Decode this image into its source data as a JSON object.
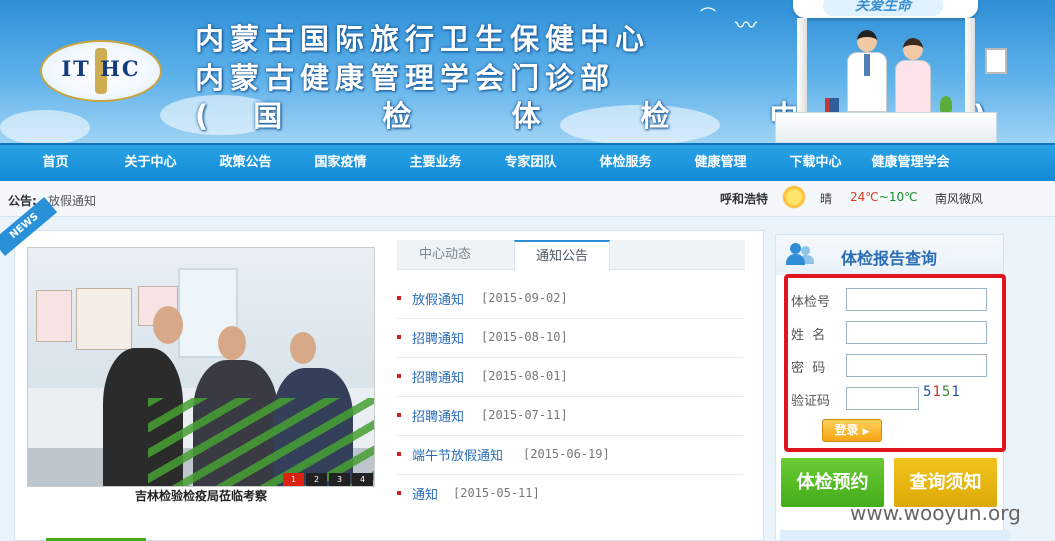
{
  "header": {
    "logo_text": "IT  HC",
    "title_line1": "内蒙古国际旅行卫生保健中心",
    "title_line2": "内蒙古健康管理学会门诊部",
    "title_line3": "(国 检 体 检 中 心)",
    "booth_sign": "关爱生命"
  },
  "nav": {
    "items": [
      "首页",
      "关于中心",
      "政策公告",
      "国家疫情",
      "主要业务",
      "专家团队",
      "体检服务",
      "健康管理",
      "下载中心",
      "健康管理学会"
    ]
  },
  "notice": {
    "label": "公告:",
    "text": "放假通知"
  },
  "weather": {
    "city": "呼和浩特",
    "condition": "晴",
    "temp_high": "24℃",
    "temp_sep": "~",
    "temp_low": "10℃",
    "wind": "南风微风",
    "icon": "sun-icon"
  },
  "news": {
    "ribbon": "NEWS",
    "caption": "吉林检验检疫局莅临考察",
    "slides": [
      "1",
      "2",
      "3",
      "4"
    ],
    "active_slide": 0
  },
  "tabs": [
    {
      "label": "中心动态"
    },
    {
      "label": "通知公告"
    }
  ],
  "active_tab": 1,
  "notices": [
    {
      "title": "放假通知",
      "date": "[2015-09-02]"
    },
    {
      "title": "招聘通知",
      "date": "[2015-08-10]"
    },
    {
      "title": "招聘通知",
      "date": "[2015-08-01]"
    },
    {
      "title": "招聘通知",
      "date": "[2015-07-11]"
    },
    {
      "title": "端午节放假通知",
      "date": "[2015-06-19]"
    },
    {
      "title": "通知",
      "date": "[2015-05-11]"
    }
  ],
  "report": {
    "title": "体检报告查询",
    "exam_no_label": "体检号",
    "name_label": "姓  名",
    "password_label": "密  码",
    "captcha_label": "验证码",
    "exam_no_value": "",
    "name_value": "",
    "password_value": "",
    "captcha_value": "",
    "captcha_code": [
      "5",
      "1",
      "5",
      "1"
    ],
    "login_label": "登录"
  },
  "buttons": {
    "appointment": "体检预约",
    "instructions": "查询须知"
  },
  "watermark": "www.wooyun.org",
  "colors": {
    "nav_blue": "#138ad6",
    "highlight_red": "#e0141e",
    "green": "#43ad1a",
    "yellow": "#dcaa06",
    "link_blue": "#2a6cb5"
  }
}
